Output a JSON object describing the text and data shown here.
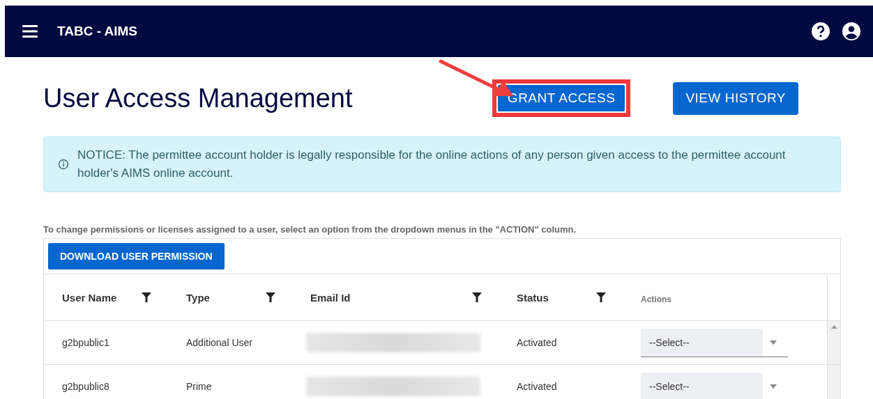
{
  "app_bar": {
    "title": "TABC - AIMS"
  },
  "page": {
    "title": "User Access Management"
  },
  "buttons": [
    {
      "label": "GRANT ACCESS",
      "highlighted": true
    },
    {
      "label": "VIEW HISTORY",
      "highlighted": false
    }
  ],
  "notice": {
    "text": "NOTICE: The permittee account holder is legally responsible for the online actions of any person given access to the permittee account holder's AIMS online account."
  },
  "instructions": "To change permissions or licenses assigned to a user, select an option from the dropdown menus in the \"ACTION\" column.",
  "download_button": {
    "label": "DOWNLOAD USER PERMISSION"
  },
  "table": {
    "columns": [
      {
        "label": "User Name",
        "filter": true
      },
      {
        "label": "Type",
        "filter": true
      },
      {
        "label": "Email Id",
        "filter": true
      },
      {
        "label": "Status",
        "filter": true
      },
      {
        "label": "Actions",
        "filter": false
      }
    ],
    "rows": [
      {
        "user_name": "g2bpublic1",
        "type": "Additional User",
        "status": "Activated",
        "action": "--Select--"
      },
      {
        "user_name": "g2bpublic8",
        "type": "Prime",
        "status": "Activated",
        "action": "--Select--"
      }
    ]
  }
}
